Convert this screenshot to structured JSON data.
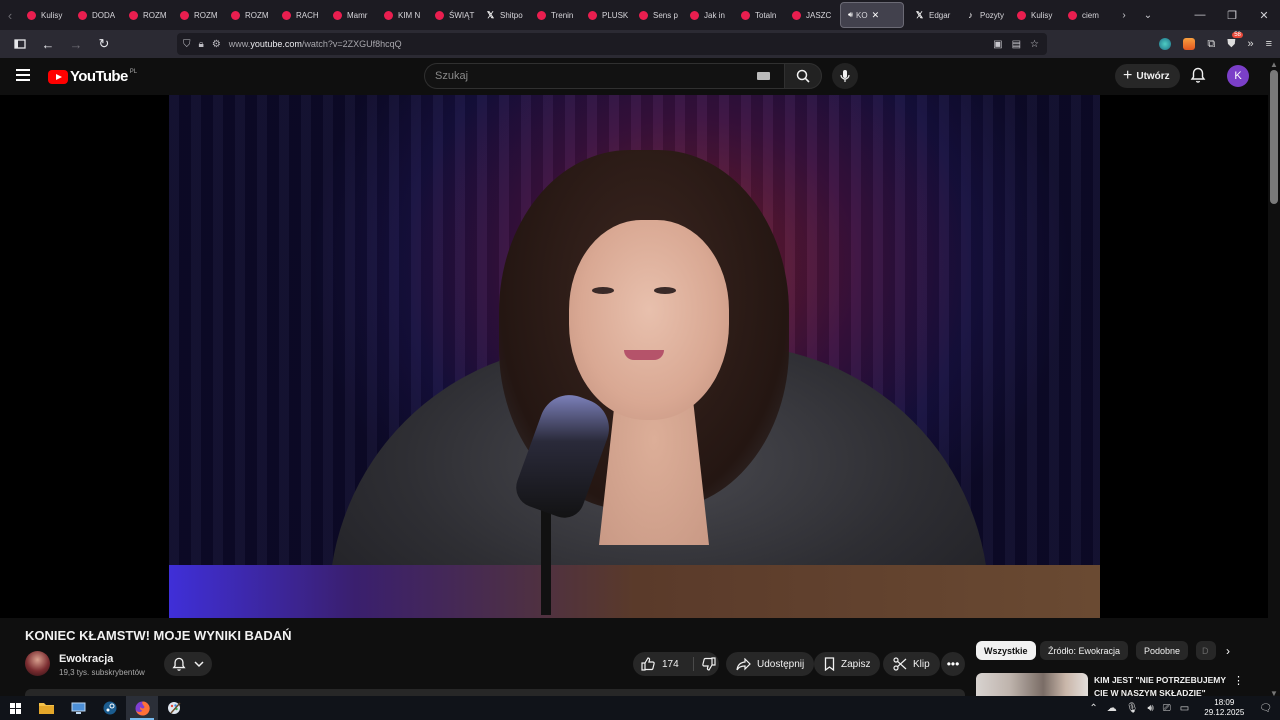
{
  "browser": {
    "tabs": [
      {
        "label": "Kulisy",
        "icon": "youtube-icon"
      },
      {
        "label": "DODA",
        "icon": "youtube-icon"
      },
      {
        "label": "ROZM",
        "icon": "youtube-icon"
      },
      {
        "label": "ROZM",
        "icon": "youtube-icon"
      },
      {
        "label": "ROZM",
        "icon": "youtube-icon"
      },
      {
        "label": "RACH",
        "icon": "youtube-icon"
      },
      {
        "label": "Mamr",
        "icon": "youtube-icon"
      },
      {
        "label": "KIM N",
        "icon": "youtube-icon"
      },
      {
        "label": "ŚWIĄT",
        "icon": "youtube-icon"
      },
      {
        "label": "Shitpo",
        "icon": "x-icon"
      },
      {
        "label": "Trenin",
        "icon": "youtube-icon"
      },
      {
        "label": "PLUSK",
        "icon": "youtube-icon"
      },
      {
        "label": "Sens p",
        "icon": "youtube-icon"
      },
      {
        "label": "Jak in",
        "icon": "youtube-icon"
      },
      {
        "label": "Totaln",
        "icon": "youtube-icon"
      },
      {
        "label": "JASZC",
        "icon": "youtube-icon"
      },
      {
        "label": "KO",
        "icon": "youtube-icon",
        "active": true
      },
      {
        "label": "Edgar",
        "icon": "x-icon"
      },
      {
        "label": "Pozyty",
        "icon": "tiktok-icon"
      },
      {
        "label": "Kulisy",
        "icon": "youtube-icon"
      },
      {
        "label": "ciem",
        "icon": "youtube-icon"
      }
    ],
    "url_prefix": "www.",
    "url_domain": "youtube.com",
    "url_path": "/watch?v=2ZXGUf8hcqQ",
    "extension_badge": "58"
  },
  "masthead": {
    "logo_text": "YouTube",
    "region": "PL",
    "search_placeholder": "Szukaj",
    "create_label": "Utwórz",
    "avatar_letter": "K"
  },
  "video": {
    "title": "KONIEC KŁAMSTW! MOJE WYNIKI BADAŃ",
    "channel_name": "Ewokracja",
    "subscribers": "19,3 tys. subskrybentów",
    "likes": "174",
    "share_label": "Udostępnij",
    "save_label": "Zapisz",
    "clip_label": "Klip"
  },
  "sidebar": {
    "chips": [
      "Wszystkie",
      "Źródło: Ewokracja",
      "Podobne",
      "D"
    ],
    "first_recommendation_title": "KIM JEST \"NIE POTRZEBUJEMY CIĘ W NASZYM SKŁADZIE\""
  },
  "taskbar": {
    "time": "18:09",
    "date": "29.12.2025"
  },
  "colors": {
    "yt_red": "#ff0000",
    "background": "#0f0f0f",
    "avatar_purple": "#7b3fc8",
    "taskbar_accent": "#76b9ed"
  }
}
